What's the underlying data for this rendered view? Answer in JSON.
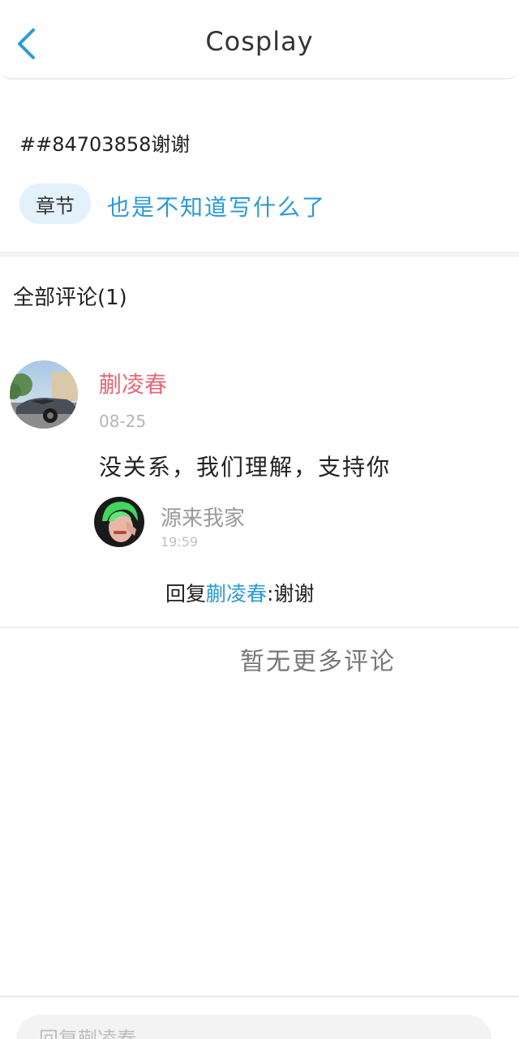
{
  "header": {
    "title": "Cosplay",
    "back_icon": "chevron-left-icon",
    "accent_color": "#2c9bd6"
  },
  "post": {
    "text": "##84703858谢谢",
    "chapter_badge": "章节",
    "chapter_title": "也是不知道写什么了"
  },
  "comments": {
    "heading": "全部评论(1)",
    "items": [
      {
        "user": "蒯凌春",
        "date": "08-25",
        "body": "没关系，我们理解，支持你",
        "reply": {
          "user": "源来我家",
          "time": "19:59",
          "prefix": "回复",
          "to": "蒯凌春",
          "text": ":谢谢"
        }
      }
    ],
    "no_more": "暂无更多评论"
  },
  "bottom": {
    "input_placeholder": "回复蒯凌春"
  },
  "colors": {
    "username_pink": "#e36a7a",
    "link_blue": "#2c9bd6",
    "badge_bg": "#e3f1fb"
  }
}
